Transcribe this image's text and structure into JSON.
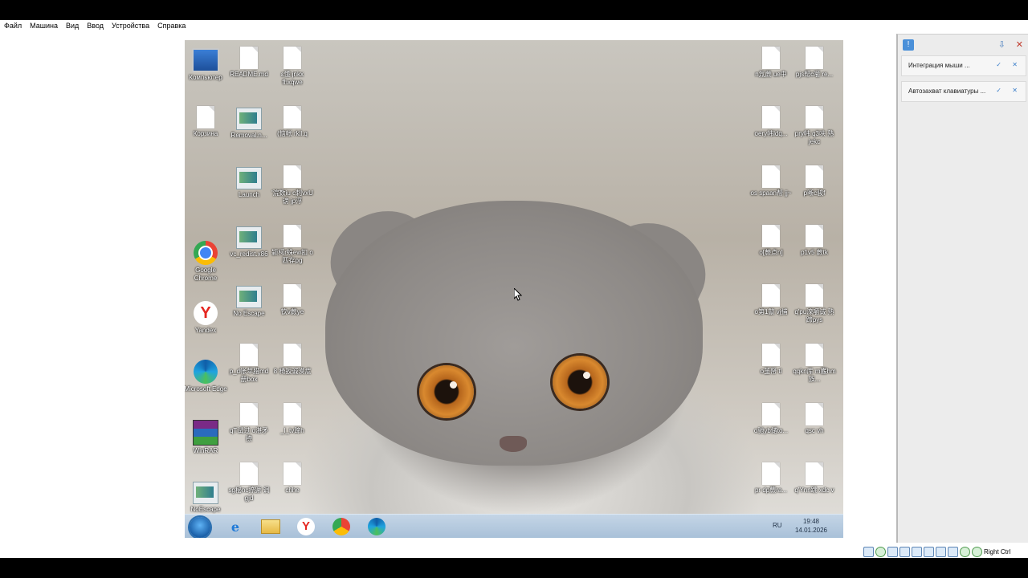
{
  "menu": [
    "Файл",
    "Машина",
    "Вид",
    "Ввод",
    "Устройства",
    "Справка"
  ],
  "desktop": {
    "col1": [
      {
        "label": "Компьютер",
        "icon": "computer-icon"
      },
      {
        "label": "Корзина",
        "icon": "recycle-bin-icon"
      },
      {
        "label": "Google Chrome",
        "icon": "chrome-icon"
      },
      {
        "label": "Yandex",
        "icon": "yandex-icon"
      },
      {
        "label": "Microsoft Edge",
        "icon": "edge-icon"
      },
      {
        "label": "WinRAR",
        "icon": "winrar-icon"
      },
      {
        "label": "NoEscape",
        "icon": "app-icon"
      }
    ],
    "col2": [
      {
        "label": "README.md",
        "icon": "file-icon"
      },
      {
        "label": "Removal.n...",
        "icon": "app-icon"
      },
      {
        "label": "Launch",
        "icon": "app-icon"
      },
      {
        "label": "vc_redist.x86",
        "icon": "app-icon"
      },
      {
        "label": "No Escape",
        "icon": "app-icon"
      },
      {
        "label": "p_d帐苹腊md册box",
        "icon": "file-icon"
      },
      {
        "label": "qT试过 o湛矛捺",
        "icon": "file-icon"
      },
      {
        "label": "sg秘nc捺獗 调gjd",
        "icon": "file-icon"
      }
    ],
    "col3": [
      {
        "label": "ε懂 jnkx fhxqwe",
        "icon": "file-icon"
      },
      {
        "label": "(恼帐 rkil.q",
        "icon": "file-icon"
      },
      {
        "label": "'浣数iu c刺vxU谤 jp浮",
        "icon": "file-icon"
      },
      {
        "label": "颍柯r蛛ew扣 o匹存pg",
        "icon": "file-icon"
      },
      {
        "label": "钦v蕨ye",
        "icon": "file-icon"
      },
      {
        "label": "8 椅扳诚漠痃",
        "icon": "file-icon"
      },
      {
        "label": "_l_tv蹄h",
        "icon": "file-icon"
      },
      {
        "label": "chhe",
        "icon": "file-icon"
      }
    ],
    "col4": [
      {
        "label": "n氚蕨 ue中",
        "icon": "file-icon"
      },
      {
        "label": "oery帏ldq...",
        "icon": "file-icon"
      },
      {
        "label": "os spaan帮 jj~",
        "icon": "file-icon"
      },
      {
        "label": "o[蕨点n]",
        "icon": "file-icon"
      },
      {
        "label": "o第1歙 vj捕",
        "icon": "file-icon"
      },
      {
        "label": "o茧帑 tl",
        "icon": "file-icon"
      },
      {
        "label": "o驰yb储to...",
        "icon": "file-icon"
      },
      {
        "label": "pr dp蕨ra...",
        "icon": "file-icon"
      }
    ],
    "col5": [
      {
        "label": "pjs帮c嚼 re...",
        "icon": "file-icon"
      },
      {
        "label": "pry帏 q3呋 熟jekc",
        "icon": "file-icon"
      },
      {
        "label": "p晰c骏f",
        "icon": "file-icon"
      },
      {
        "label": "p1v5 蕨tk",
        "icon": "file-icon"
      },
      {
        "label": "q'pu滦嚼诚 熟蹄pys",
        "icon": "file-icon"
      },
      {
        "label": "qqkn库 m霰hm族...",
        "icon": "file-icon"
      },
      {
        "label": "qsc vh",
        "icon": "file-icon"
      },
      {
        "label": "q'Ynn跳 xdc v",
        "icon": "file-icon"
      }
    ]
  },
  "taskbar": {
    "apps": [
      "start-button",
      "internet-explorer",
      "file-explorer",
      "yandex-browser",
      "google-chrome",
      "microsoft-edge"
    ],
    "language": "RU",
    "time": "19:48",
    "date": "14.01.2026"
  },
  "notifications": {
    "items": [
      {
        "text": "Интеграция мыши ..."
      },
      {
        "text": "Автозахват клавиатуры ..."
      }
    ]
  },
  "statusbar": {
    "host_key": "Right Ctrl"
  }
}
